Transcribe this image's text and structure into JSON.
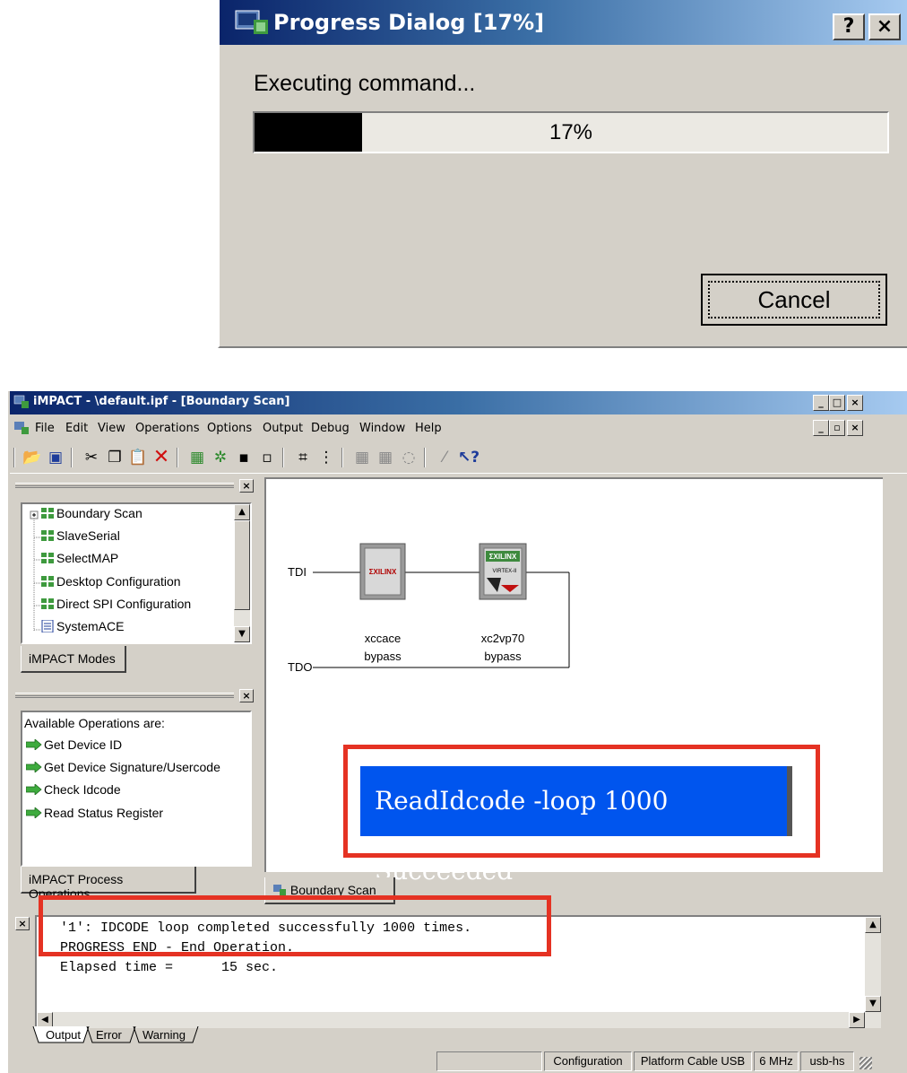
{
  "progress_dialog": {
    "title": "Progress Dialog [17%]",
    "help_button": "?",
    "close_button": "×",
    "message": "Executing command...",
    "progress_fraction": 0.17,
    "progress_text": "17%",
    "cancel_label": "Cancel"
  },
  "main_window": {
    "title": "iMPACT - \\default.ipf - [Boundary Scan]",
    "title_icon": "impact-app-icon",
    "minimize_glyph": "_",
    "maximize_glyph": "□",
    "close_glyph": "×",
    "menu": [
      "File",
      "Edit",
      "View",
      "Operations",
      "Options",
      "Output",
      "Debug",
      "Window",
      "Help"
    ],
    "child_controls": [
      "_",
      "▫",
      "×"
    ],
    "toolbar_icons": [
      "open-folder-icon",
      "save-icon",
      "cut-icon",
      "copy-icon",
      "paste-icon",
      "delete-icon",
      "chain-icon",
      "debug-chain-icon",
      "grid-icon",
      "grid-small-icon",
      "chip-icon",
      "pins-icon",
      "identify-icon",
      "assign-icon",
      "program-icon",
      "wand-icon",
      "help-pointer-icon"
    ]
  },
  "modes_panel": {
    "close": "×",
    "items": [
      "Boundary Scan",
      "SlaveSerial",
      "SelectMAP",
      "Desktop Configuration",
      "Direct SPI Configuration",
      "SystemACE"
    ],
    "tab_label": "iMPACT Modes"
  },
  "operations_panel": {
    "close": "×",
    "header": "Available Operations are:",
    "items": [
      "Get Device ID",
      "Get Device Signature/Usercode",
      "Check Idcode",
      "Read Status Register"
    ],
    "tab_label": "iMPACT Process Operations"
  },
  "boundary_scan": {
    "tdi_label": "TDI",
    "tdo_label": "TDO",
    "devices": [
      {
        "logo": "XILINX",
        "name": "xccace",
        "status": "bypass"
      },
      {
        "logo": "XILINX",
        "sub_logo": "VIRTEX-II PRO",
        "name": "xc2vp70",
        "status": "bypass"
      }
    ],
    "banner_text": "ReadIdcode -loop 1000 Succeeded",
    "tab_label": "Boundary Scan",
    "highlight_color": "#e53223",
    "banner_color": "#0055ee"
  },
  "output_console": {
    "close": "×",
    "lines": [
      "'1': IDCODE loop completed successfully 1000 times.",
      "PROGRESS_END - End Operation.",
      "Elapsed time =      15 sec."
    ],
    "tabs": [
      "Output",
      "Error",
      "Warning"
    ]
  },
  "status_bar": {
    "cells": [
      "Configuration",
      "Platform Cable USB",
      "6 MHz",
      "usb-hs"
    ]
  }
}
